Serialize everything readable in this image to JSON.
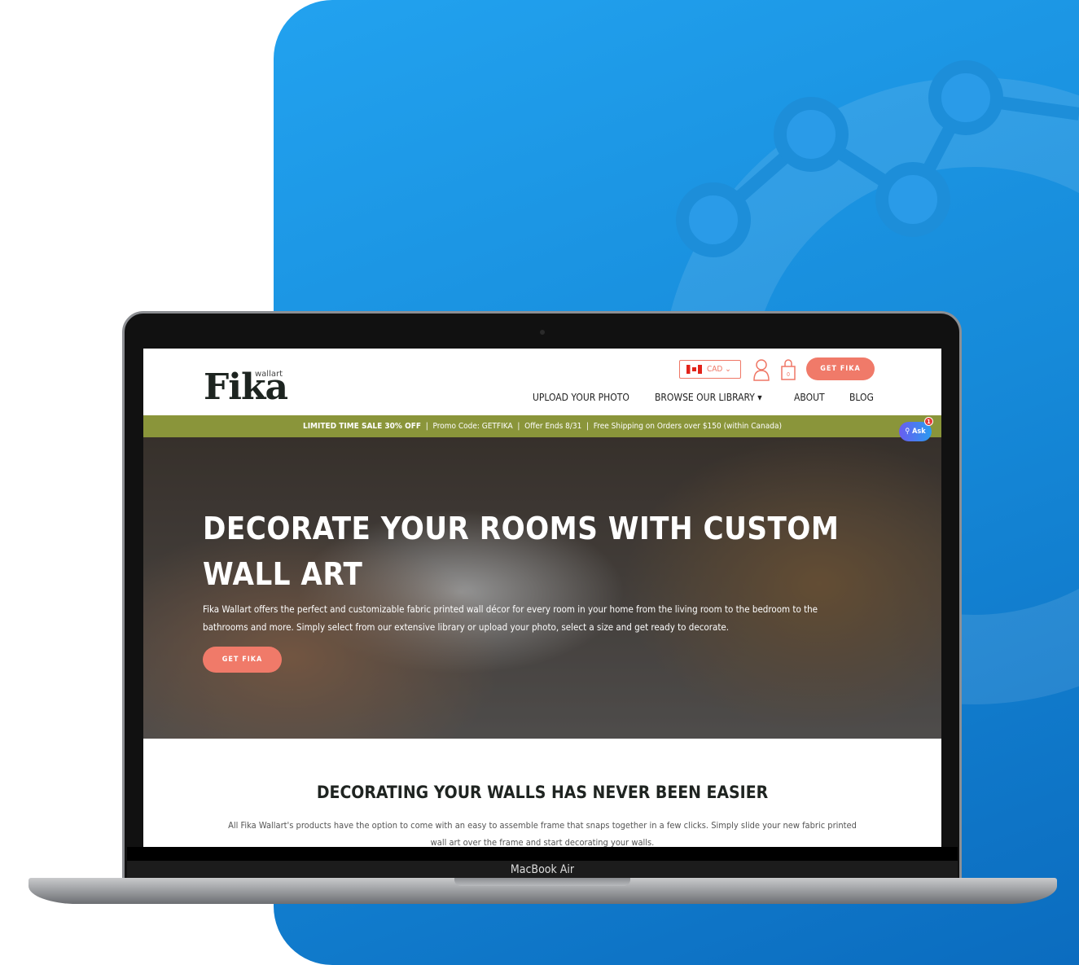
{
  "site": {
    "logo": "Fika",
    "logo_sub": "wallart",
    "currency": "CAD",
    "cart_count": "0",
    "cta": "GET FIKA",
    "nav": [
      "UPLOAD YOUR PHOTO",
      "BROWSE OUR LIBRARY",
      "ABOUT",
      "BLOG"
    ],
    "promo": {
      "sale": "LIMITED TIME SALE 30% OFF",
      "code": "Promo Code: GETFIKA",
      "ends": "Offer Ends 8/31",
      "shipping": "Free Shipping on Orders over $150 (within Canada)"
    },
    "ask": {
      "label": "Ask",
      "badge": "1"
    },
    "hero": {
      "title": "DECORATE YOUR ROOMS WITH CUSTOM WALL ART",
      "text": "Fika Wallart offers the perfect and customizable fabric printed wall décor for every room in your home from the living room to the bedroom to the bathrooms and more. Simply select from our extensive library or upload your photo, select a size and get ready to decorate.",
      "cta": "GET FIKA"
    },
    "section": {
      "title": "DECORATING YOUR WALLS HAS NEVER BEEN EASIER",
      "text": "All Fika Wallart's products have the option to come with an easy to assemble frame that snaps together in a few clicks. Simply slide your new fabric printed wall art over the frame and start decorating your walls."
    }
  },
  "device": {
    "label": "MacBook Air"
  },
  "colors": {
    "accent": "#f07a69",
    "promo_bar": "#8a953a",
    "panel": "#1a90e0"
  }
}
